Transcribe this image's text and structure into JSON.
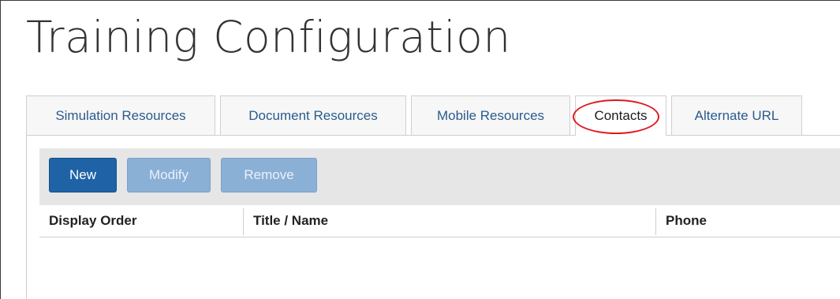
{
  "page": {
    "title": "Training Configuration"
  },
  "tabs": [
    {
      "label": "Simulation Resources",
      "active": false
    },
    {
      "label": "Document Resources",
      "active": false
    },
    {
      "label": "Mobile Resources",
      "active": false
    },
    {
      "label": "Contacts",
      "active": true,
      "highlighted": true
    },
    {
      "label": "Alternate URL",
      "active": false
    }
  ],
  "toolbar": {
    "new_label": "New",
    "modify_label": "Modify",
    "remove_label": "Remove"
  },
  "table": {
    "columns": [
      "Display Order",
      "Title / Name",
      "Phone"
    ],
    "rows": []
  },
  "colors": {
    "primary_button": "#1f63a6",
    "disabled_button": "#8ab0d6",
    "tab_text": "#2a5b8d",
    "highlight_oval": "#e01b1b",
    "toolbar_bg": "#e6e6e6"
  }
}
